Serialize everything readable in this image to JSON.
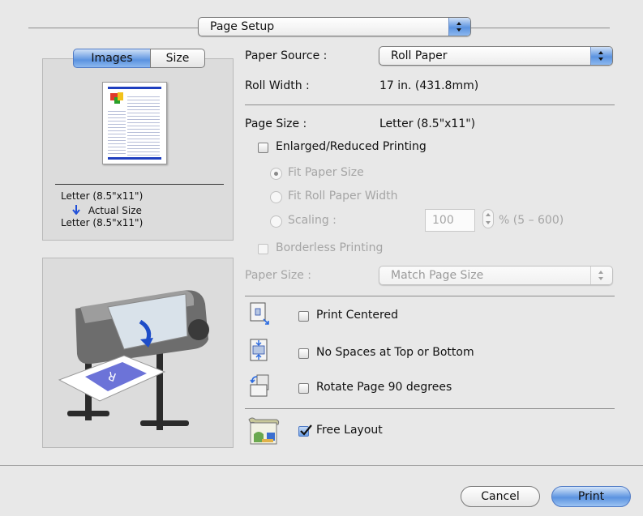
{
  "header": {
    "mode_select": "Page Setup"
  },
  "preview": {
    "tabs": [
      {
        "label": "Images",
        "selected": true
      },
      {
        "label": "Size",
        "selected": false
      }
    ],
    "orig_size": "Letter (8.5\"x11\")",
    "scale_text": "Actual Size",
    "output_size": "Letter (8.5\"x11\")"
  },
  "settings": {
    "paper_source_label": "Paper Source :",
    "paper_source_value": "Roll Paper",
    "roll_width_label": "Roll Width :",
    "roll_width_value": "17 in. (431.8mm)",
    "page_size_label": "Page Size :",
    "page_size_value": "Letter (8.5\"x11\")",
    "enlarged_label": "Enlarged/Reduced Printing",
    "enlarged_checked": false,
    "fit_paper_label": "Fit Paper Size",
    "fit_roll_label": "Fit Roll Paper Width",
    "scaling_label": "Scaling :",
    "scaling_value": "100",
    "scaling_range": "% (5 – 600)",
    "borderless_label": "Borderless Printing",
    "paper_size_label": "Paper Size :",
    "paper_size_value": "Match Page Size",
    "print_centered_label": "Print Centered",
    "no_spaces_label": "No Spaces at Top or Bottom",
    "rotate_label": "Rotate Page 90 degrees",
    "free_layout_label": "Free Layout",
    "free_layout_checked": true
  },
  "buttons": {
    "cancel": "Cancel",
    "print": "Print"
  },
  "colors": {
    "accent": "#5b93e0",
    "disabled_text": "#a5a5a5"
  },
  "icons": [
    "updown-arrows-icon",
    "down-arrow-icon",
    "print-centered-icon",
    "no-spaces-icon",
    "rotate-page-icon",
    "free-layout-icon",
    "printer-illustration"
  ]
}
